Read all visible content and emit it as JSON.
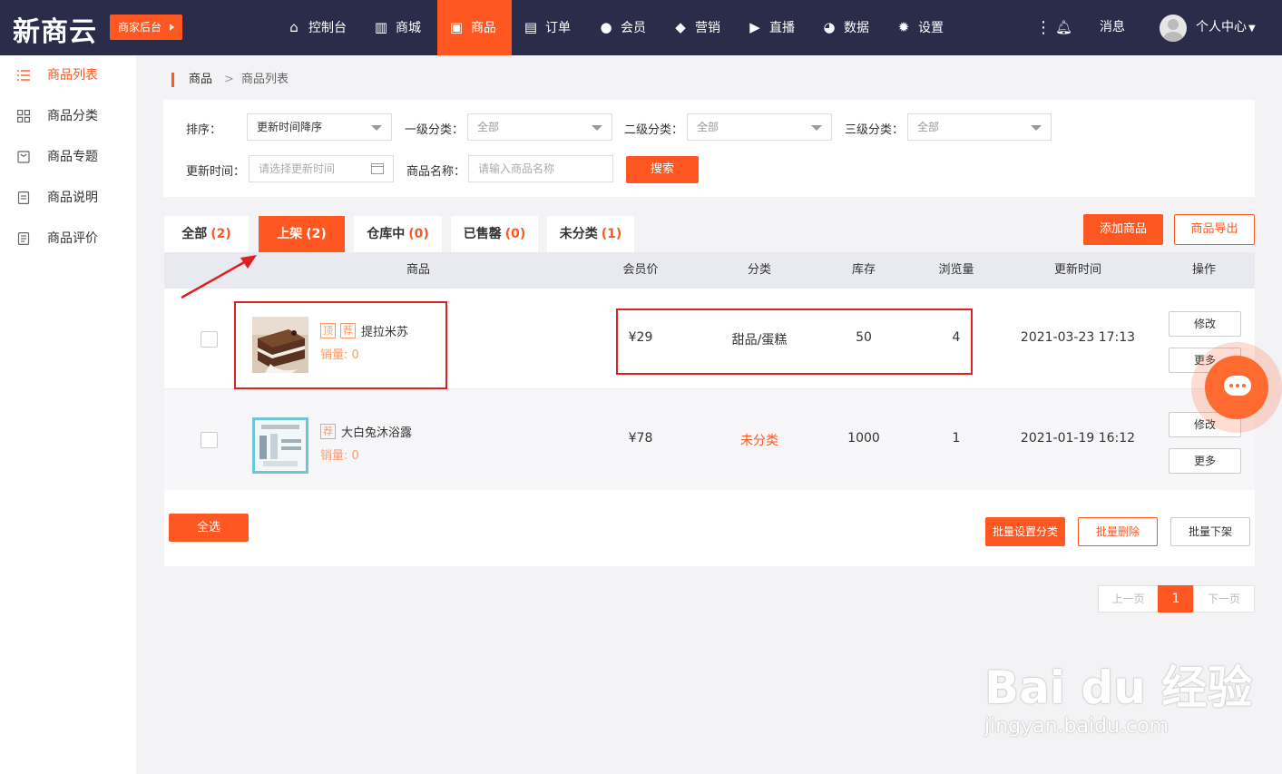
{
  "header": {
    "logo": "新商云",
    "merchant_label": "商家后台",
    "nav": [
      {
        "label": "控制台",
        "icon": "home-icon"
      },
      {
        "label": "商城",
        "icon": "building-icon"
      },
      {
        "label": "商品",
        "icon": "bag-icon",
        "active": true
      },
      {
        "label": "订单",
        "icon": "clipboard-icon"
      },
      {
        "label": "会员",
        "icon": "user-icon"
      },
      {
        "label": "营销",
        "icon": "cube-icon"
      },
      {
        "label": "直播",
        "icon": "tv-icon"
      },
      {
        "label": "数据",
        "icon": "pie-chart-icon"
      },
      {
        "label": "设置",
        "icon": "gear-icon"
      }
    ],
    "messages_label": "消息",
    "profile_label": "个人中心"
  },
  "sidebar": {
    "items": [
      {
        "label": "商品列表",
        "icon": "list-icon",
        "active": true
      },
      {
        "label": "商品分类",
        "icon": "grid-icon"
      },
      {
        "label": "商品专题",
        "icon": "bag-outline-icon"
      },
      {
        "label": "商品说明",
        "icon": "doc-icon"
      },
      {
        "label": "商品评价",
        "icon": "comment-doc-icon"
      }
    ]
  },
  "breadcrumb": {
    "root": "商品",
    "separator": ">",
    "current": "商品列表"
  },
  "filters": {
    "sort_label": "排序：",
    "sort_value": "更新时间降序",
    "cat1_label": "一级分类：",
    "cat1_value": "全部",
    "cat2_label": "二级分类：",
    "cat2_value": "全部",
    "cat3_label": "三级分类：",
    "cat3_value": "全部",
    "time_label": "更新时间：",
    "time_placeholder": "请选择更新时间",
    "name_label": "商品名称：",
    "name_placeholder": "请输入商品名称",
    "search_label": "搜索"
  },
  "tabs": [
    {
      "label": "全部",
      "count": "(2)"
    },
    {
      "label": "上架",
      "count": "(2)",
      "active": true
    },
    {
      "label": "仓库中",
      "count": "(0)"
    },
    {
      "label": "已售罄",
      "count": "(0)"
    },
    {
      "label": "未分类",
      "count": "(1)"
    }
  ],
  "actions": {
    "add_label": "添加商品",
    "export_label": "商品导出"
  },
  "table": {
    "headers": [
      "商品",
      "会员价",
      "分类",
      "库存",
      "浏览量",
      "更新时间",
      "操作"
    ],
    "rows": [
      {
        "tags": [
          "顶",
          "荐"
        ],
        "name": "提拉米苏",
        "sales": "销量: 0",
        "price": "¥29",
        "category": "甜品/蛋糕",
        "stock": "50",
        "views": "4",
        "updated": "2021-03-23 17:13",
        "edit": "修改",
        "more": "更多"
      },
      {
        "tags": [
          "荐"
        ],
        "name": "大白兔沐浴露",
        "sales": "销量: 0",
        "price": "¥78",
        "category": "未分类",
        "stock": "1000",
        "views": "1",
        "updated": "2021-01-19 16:12",
        "edit": "修改",
        "more": "更多"
      }
    ]
  },
  "bulk": {
    "select_all": "全选",
    "set_category": "批量设置分类",
    "delete": "批量删除",
    "take_down": "批量下架"
  },
  "pagination": {
    "prev": "上一页",
    "current": "1",
    "next": "下一页"
  },
  "watermark": {
    "brand": "Bai  du 经验",
    "url": "jingyan.baidu.com"
  },
  "colors": {
    "accent": "#ff5722",
    "header_bg": "#2b2c4a",
    "annotation": "#e02020"
  }
}
